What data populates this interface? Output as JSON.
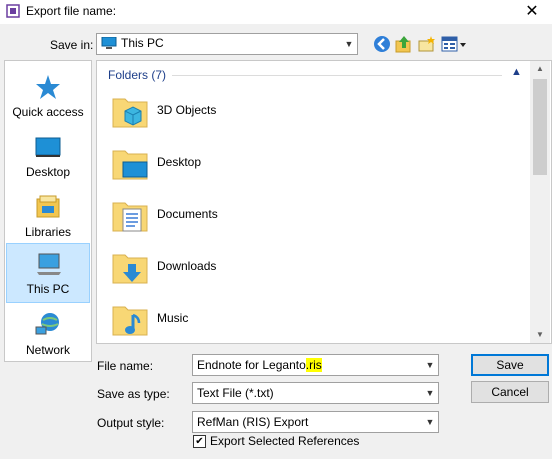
{
  "window": {
    "title": "Export file name:",
    "close_glyph": "✕"
  },
  "save_in": {
    "label": "Save in:",
    "value": "This PC"
  },
  "sidebar": {
    "items": [
      {
        "label": "Quick access",
        "icon": "quick-access-star-icon"
      },
      {
        "label": "Desktop",
        "icon": "desktop-icon"
      },
      {
        "label": "Libraries",
        "icon": "libraries-icon"
      },
      {
        "label": "This PC",
        "icon": "this-pc-icon",
        "selected": true
      },
      {
        "label": "Network",
        "icon": "network-icon"
      }
    ]
  },
  "file_list": {
    "group_header": "Folders (7)",
    "folders": [
      {
        "name": "3D Objects",
        "icon": "3d-objects-folder-icon"
      },
      {
        "name": "Desktop",
        "icon": "desktop-folder-icon"
      },
      {
        "name": "Documents",
        "icon": "documents-folder-icon"
      },
      {
        "name": "Downloads",
        "icon": "downloads-folder-icon"
      },
      {
        "name": "Music",
        "icon": "music-folder-icon"
      }
    ]
  },
  "form": {
    "file_name_label": "File name:",
    "file_name_value_main": "Endnote for Leganto",
    "file_name_value_ext": ".ris",
    "save_type_label": "Save as type:",
    "save_type_value": "Text File (*.txt)",
    "output_style_label": "Output style:",
    "output_style_value": "RefMan (RIS) Export",
    "export_selected_label": "Export Selected References",
    "export_selected_checked": true
  },
  "buttons": {
    "save": "Save",
    "cancel": "Cancel"
  },
  "colors": {
    "accent": "#0078d7",
    "selection": "#cce8ff",
    "folder": "#f8d775",
    "highlight": "#ffff00"
  }
}
